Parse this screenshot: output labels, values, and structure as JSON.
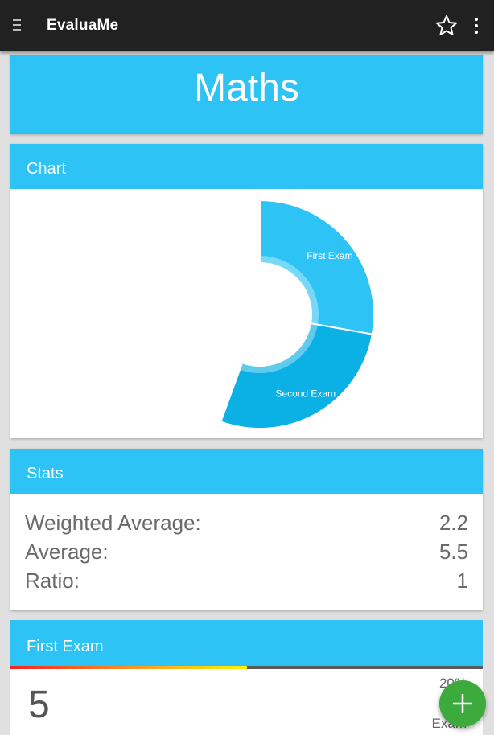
{
  "app_bar": {
    "title": "EvaluaMe",
    "menu_icon": "hamburger-menu-icon",
    "favorite_icon": "star-outline-icon",
    "overflow_icon": "more-vertical-icon"
  },
  "subject": {
    "title": "Maths"
  },
  "chart_card": {
    "header": "Chart",
    "chart_data": {
      "type": "pie",
      "categories": [
        "First Exam",
        "Second Exam"
      ],
      "values": [
        50,
        50
      ],
      "colors": [
        "#2ec3f5",
        "#0bb0e4"
      ]
    }
  },
  "stats_card": {
    "header": "Stats",
    "rows": [
      {
        "label": "Weighted Average:",
        "value": "2.2"
      },
      {
        "label": "Average:",
        "value": "5.5"
      },
      {
        "label": "Ratio:",
        "value": "1"
      }
    ]
  },
  "exam_card": {
    "header": "First Exam",
    "grade": "5",
    "grade_fraction": 0.5,
    "weight": "20%",
    "date": "--/--",
    "type": "Exam"
  },
  "fab": {
    "icon": "plus-icon"
  },
  "colors": {
    "accent": "#2ec3f5",
    "toolbar": "#212121",
    "fab": "#3daa3d"
  }
}
